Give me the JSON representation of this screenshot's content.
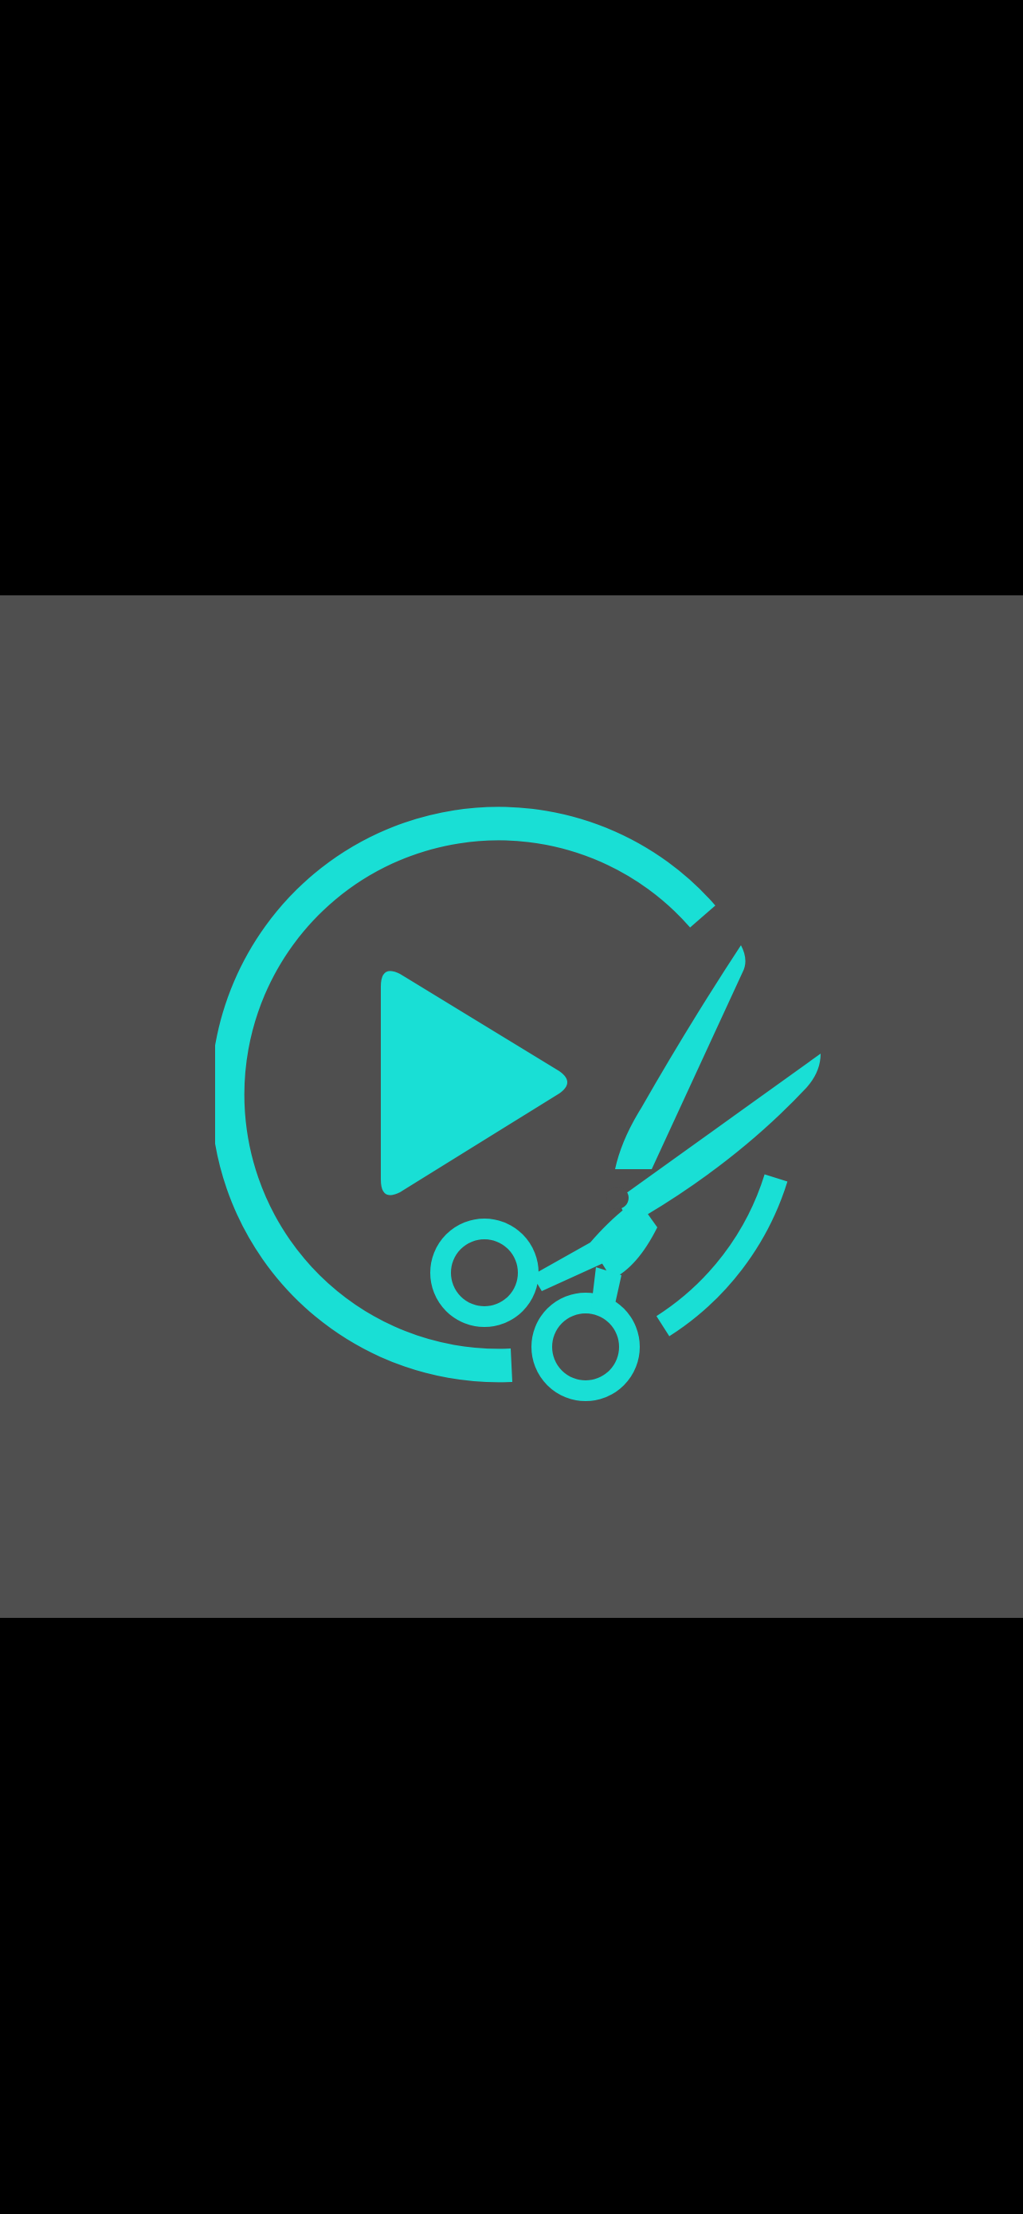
{
  "screen": {
    "background_color": "#000000",
    "panel_color": "#4f4f4f"
  },
  "logo": {
    "icon": "video-cut-logo-icon",
    "accent_color": "#19dfd5",
    "parts": [
      "circle-arc-icon",
      "play-triangle-icon",
      "scissors-icon"
    ]
  }
}
